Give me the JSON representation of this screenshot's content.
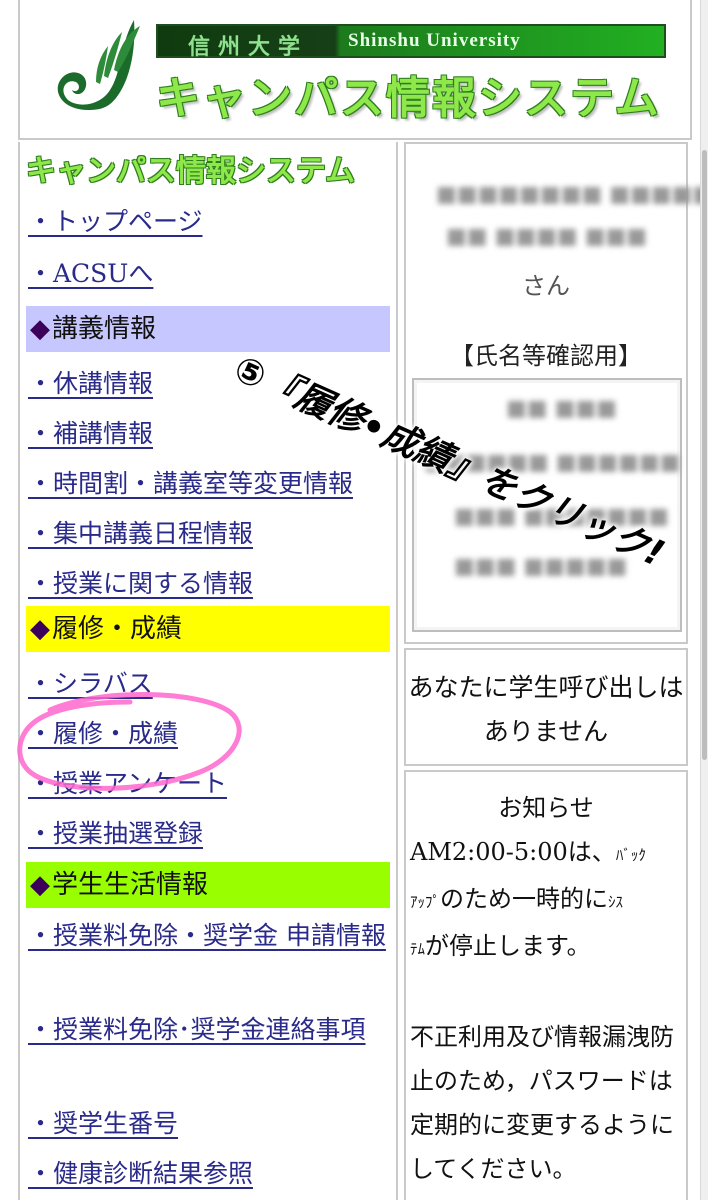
{
  "header": {
    "uni_jp": "信州大学",
    "uni_en": "Shinshu University",
    "system_title": "キャンパス情報システム"
  },
  "nav": {
    "title": "キャンパス情報システム",
    "top_links": [
      {
        "label": "・トップページ"
      },
      {
        "label": "・ACSUへ"
      }
    ],
    "sections": [
      {
        "label": "講義情報",
        "color": "#c7c7ff"
      },
      {
        "label": "履修・成績",
        "color": "#ffff00"
      },
      {
        "label": "学生生活情報",
        "color": "#99ff00"
      }
    ],
    "lecture_links": [
      {
        "label": "・休講情報"
      },
      {
        "label": "・補講情報"
      },
      {
        "label": "・時間割・講義室等変更情報"
      },
      {
        "label": "・集中講義日程情報"
      },
      {
        "label": "・授業に関する情報"
      }
    ],
    "record_links": [
      {
        "label": "・シラバス"
      },
      {
        "label": "・履修・成績"
      },
      {
        "label": "・授業アンケート"
      },
      {
        "label": "・授業抽選登録"
      }
    ],
    "life_links": [
      {
        "label": "・授業料免除・奨学金 申請情報"
      },
      {
        "label": "・授業料免除･奨学金連絡事項"
      },
      {
        "label": "・奨学生番号"
      },
      {
        "label": "・健康診断結果参照"
      }
    ]
  },
  "user_panel": {
    "suffix": "さん",
    "confirm_label": "【氏名等確認用】"
  },
  "call_notice": "あなたに学生呼び出しはありません",
  "notice": {
    "title": "お知らせ",
    "line1_a": "AM2:00-5:00は、",
    "line1_b": "ﾊﾞｯｸ",
    "line2_a": "ｱｯﾌﾟ",
    "line2_b": "のため一時的に",
    "line2_c": "ｼｽ",
    "line3_a": "ﾃﾑ",
    "line3_b": "が停止します。",
    "para2": "不正利用及び情報漏洩防止のため，パスワードは定期的に変更するようにしてください。"
  },
  "annotation": {
    "text": "⑤『履修•成績』をクリック!",
    "color": "#000000",
    "circle_color": "#ff66cc"
  }
}
